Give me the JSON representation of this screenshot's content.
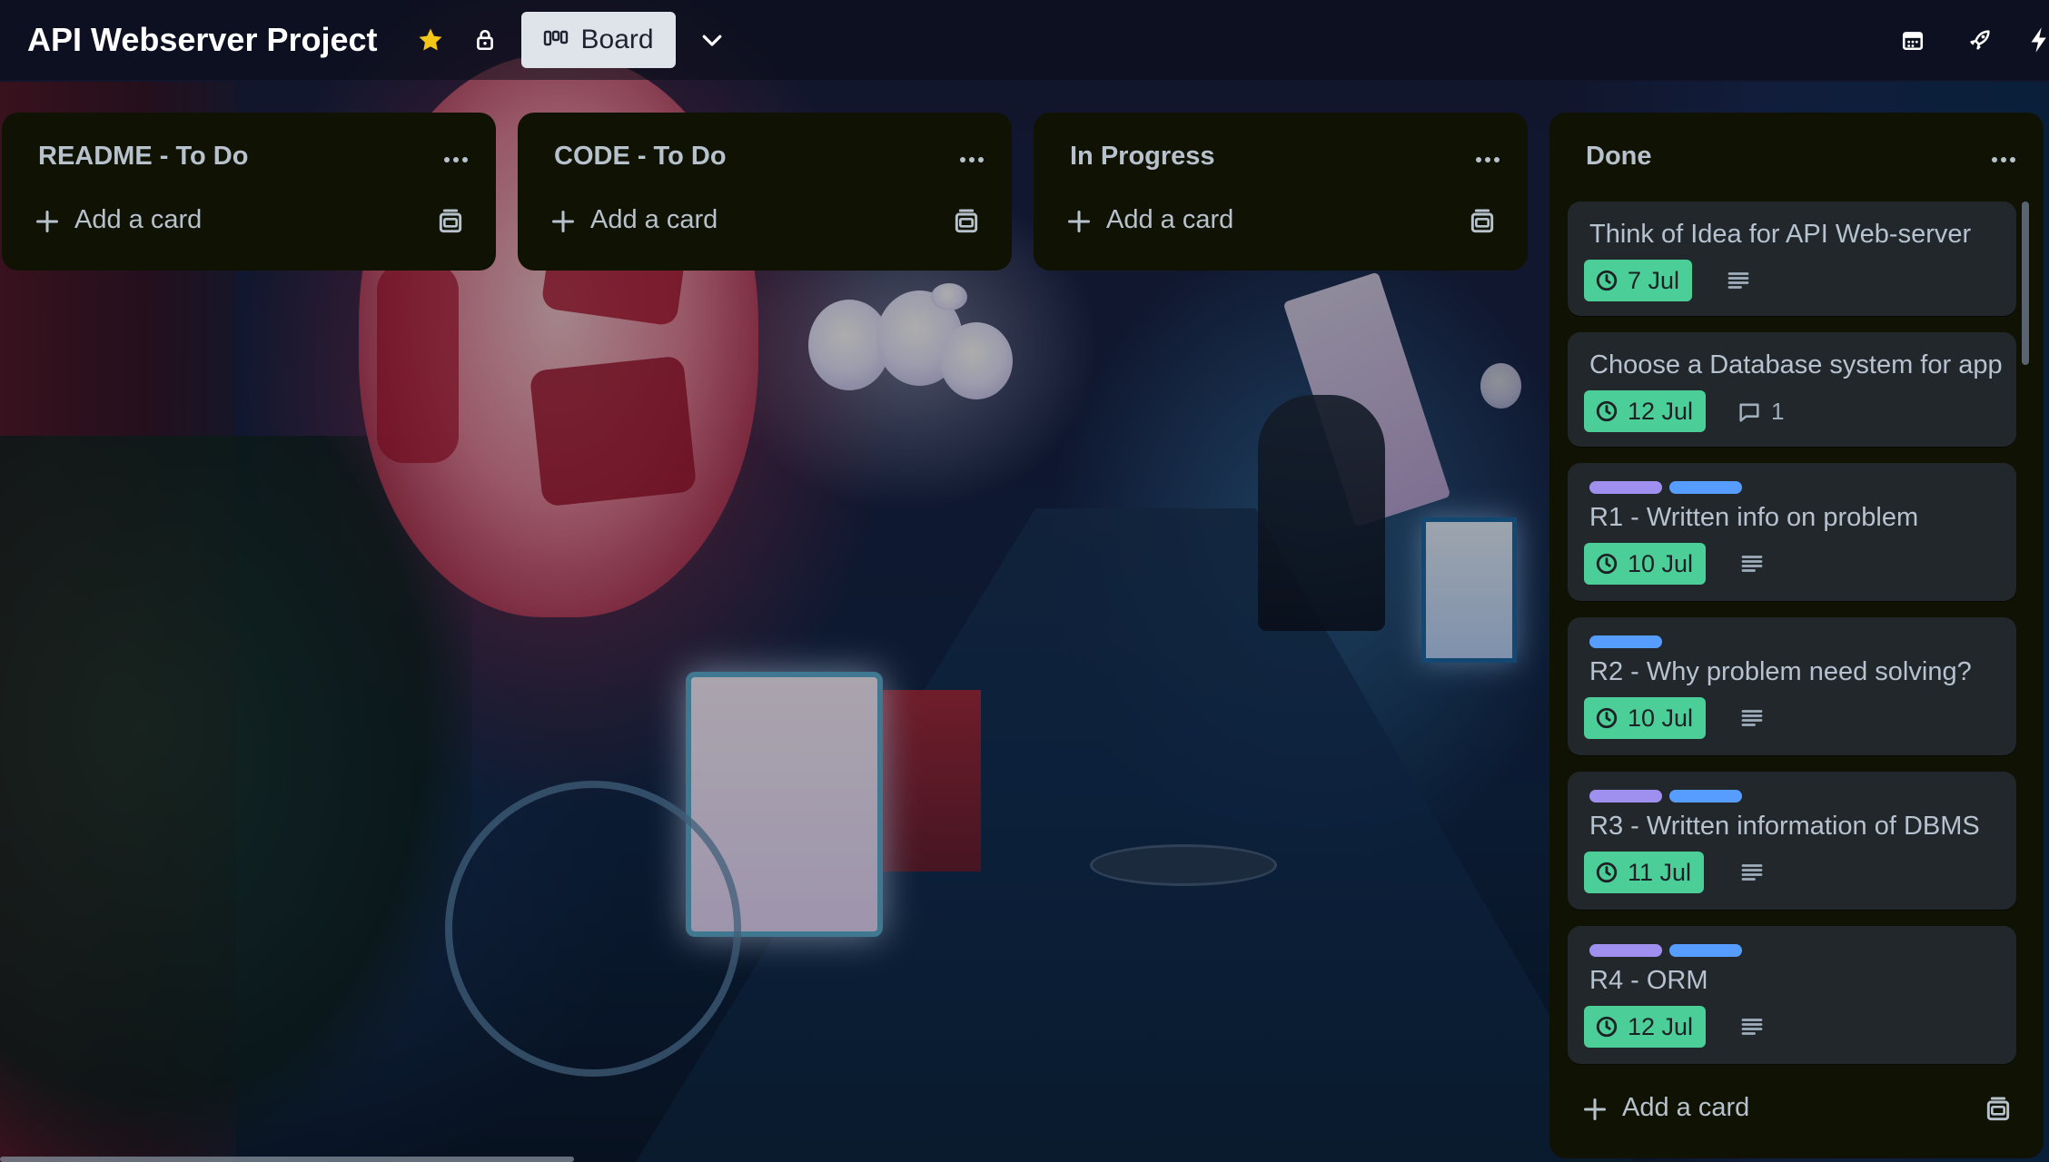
{
  "header": {
    "title": "API Webserver Project",
    "view_button_label": "Board",
    "star_color": "#f5c518"
  },
  "lists": [
    {
      "title": "README - To Do",
      "add_card_label": "Add a card",
      "cards": []
    },
    {
      "title": "CODE - To Do",
      "add_card_label": "Add a card",
      "cards": []
    },
    {
      "title": "In Progress",
      "add_card_label": "Add a card",
      "cards": []
    },
    {
      "title": "Done",
      "add_card_label": "Add a card",
      "cards": [
        {
          "title": "Think of Idea for API Web-server",
          "labels": [],
          "due": "7 Jul",
          "has_description": true
        },
        {
          "title": "Choose a Database system for app",
          "labels": [],
          "due": "12 Jul",
          "comments": "1"
        },
        {
          "title": "R1 - Written info on problem",
          "labels": [
            "purple",
            "blue"
          ],
          "due": "10 Jul",
          "has_description": true
        },
        {
          "title": "R2 - Why problem need solving?",
          "labels": [
            "blue"
          ],
          "due": "10 Jul",
          "has_description": true
        },
        {
          "title": "R3 - Written information of DBMS",
          "labels": [
            "purple",
            "blue"
          ],
          "due": "11 Jul",
          "has_description": true
        },
        {
          "title": "R4 - ORM",
          "labels": [
            "purple",
            "blue"
          ],
          "due": "12 Jul",
          "has_description": true
        }
      ]
    }
  ],
  "colors": {
    "due_badge": "#4bce97",
    "label_purple": "#9f8fef",
    "label_blue": "#579dff",
    "list_bg": "#101204",
    "card_bg": "#22272b"
  },
  "icons": {
    "header_right": [
      "calendar-icon",
      "rocket-icon",
      "lightning-icon"
    ]
  }
}
